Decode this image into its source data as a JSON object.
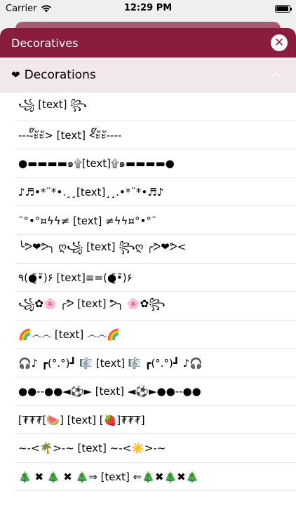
{
  "status_bar": {
    "carrier": "Carrier",
    "time": "12:29 PM",
    "battery_level": 0.92
  },
  "sheet": {
    "title": "Decoratives",
    "close_icon": "close-icon",
    "accent_color": "#8a1c3e",
    "section": {
      "icon": "heart-icon",
      "icon_glyph": "❤",
      "label": "Decorations",
      "expanded": true
    },
    "items": [
      "꧁ [text] ꧂",
      "----ั๊ะัะั> [text] <ั๊ะัะั----",
      "●▬▬▬▬๑۩[text]۩๑▬▬▬▬●",
      "♪♬•*¨*•.¸¸[text]¸¸.•*¨*•♬♪",
      "¯°•°¤ϟϟ≠ [text] ≠ϟϟ¤°•°¯",
      "╰ᕗ❤ᕗ╮ ღ꧁ [text] ꧂ღ ╭ᕗ❤ᕗ<",
      "٩(●̮̮̃•̃)۶ [text]≡=(●̮̮̃•̃)۶",
      "꧁✿🌸 ╭ᕗ [text] ᕗ╮ 🌸✿꧂",
      "🌈෴෴ [text] ෴෴🌈",
      "🎧♪ ┏(°.°)┛ 🎼 [text] 🎼 ┏(°.°)┛ ♪🎧",
      "●●--●●◄⚽► [text] ◄⚽►●●--●●",
      "[₮₮₮[🍉] [text] [🍓]₮₮₮]",
      "~-<🌴>-~ [text] ~-<☀️>-~",
      "🎄 ✖ 🎄 ✖ 🎄⇒ [text] ⇐🎄✖🎄✖🎄"
    ]
  }
}
